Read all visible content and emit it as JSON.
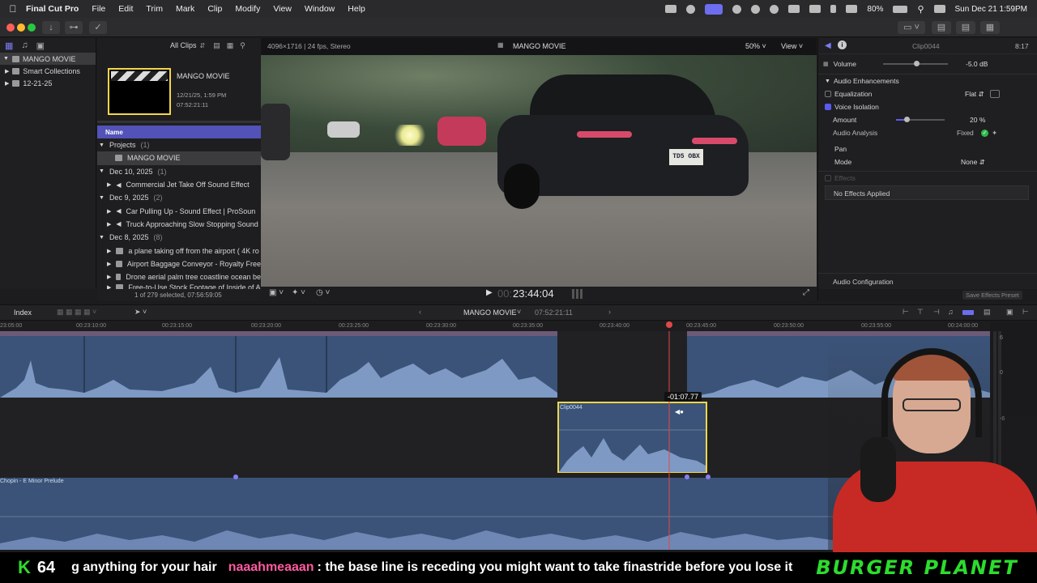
{
  "menubar": {
    "app_name": "Final Cut Pro",
    "menus": [
      "File",
      "Edit",
      "Trim",
      "Mark",
      "Clip",
      "Modify",
      "View",
      "Window",
      "Help"
    ],
    "battery": "80%",
    "datetime": "Sun Dec 21  1:59PM"
  },
  "browser": {
    "library": "MANGO MOVIE",
    "sidebar": [
      "Smart Collections",
      "12-21-25"
    ],
    "filter": "All Clips",
    "project_card": {
      "name": "MANGO MOVIE",
      "date": "12/21/25, 1:59 PM",
      "duration": "07:52:21:11"
    },
    "column_header": "Name",
    "groups": [
      {
        "label": "Projects",
        "count": "(1)",
        "items": [
          "MANGO MOVIE"
        ]
      },
      {
        "label": "Dec 10, 2025",
        "count": "(1)",
        "items": [
          "Commercial Jet Take Off Sound Effect"
        ]
      },
      {
        "label": "Dec 9, 2025",
        "count": "(2)",
        "items": [
          "Car Pulling Up - Sound Effect  |  ProSoun",
          "Truck Approaching Slow Stopping Sound"
        ]
      },
      {
        "label": "Dec 8, 2025",
        "count": "(8)",
        "items": [
          "a plane taking off from the airport ( 4K ro",
          "Airport Baggage Conveyor - Royalty Free",
          "Drone aerial palm tree coastline ocean be",
          "Free-to-Use Stock Footage of Inside of A"
        ]
      }
    ],
    "selection_status": "1 of 279 selected, 07:56:59:05"
  },
  "viewer": {
    "format": "4096×1716 | 24 fps, Stereo",
    "title": "MANGO MOVIE",
    "zoom": "50%",
    "view_label": "View",
    "plate": "TD5 OBX",
    "timecode_dim": "00:",
    "timecode": "23:44:04"
  },
  "inspector": {
    "clip_name": "Clip0044",
    "clip_time": "8:17",
    "volume_label": "Volume",
    "volume_value": "-5.0  dB",
    "enhancements_label": "Audio Enhancements",
    "equalization_label": "Equalization",
    "equalization_value": "Flat",
    "voice_isolation_label": "Voice Isolation",
    "amount_label": "Amount",
    "amount_value": "20  %",
    "analysis_label": "Audio Analysis",
    "analysis_value": "Fixed",
    "pan_label": "Pan",
    "mode_label": "Mode",
    "mode_value": "None",
    "effects_label": "Effects",
    "no_effects": "No Effects Applied",
    "audio_config": "Audio Configuration",
    "save_preset": "Save Effects Preset"
  },
  "timeline": {
    "index_label": "Index",
    "project": "MANGO MOVIE",
    "duration": "07:52:21:11",
    "ruler_ticks": [
      "23:05:00",
      "00:23:10:00",
      "00:23:15:00",
      "00:23:20:00",
      "00:23:25:00",
      "00:23:30:00",
      "00:23:35:00",
      "00:23:40:00",
      "00:23:45:00",
      "00:23:50:00",
      "00:23:55:00",
      "00:24:00:00"
    ],
    "clip_label": "Clip0044",
    "trim_readout": "-01:07.77",
    "music_label": "Chopin - E Minor Prelude",
    "meter_labels": [
      "6",
      "0",
      "-6"
    ]
  },
  "ticker": {
    "score_letter": "K",
    "score_number": "64",
    "text_before": "g anything for your hair",
    "username": "naaahmeaaan",
    "message": ": the base line is receding you might want to take finastride before you lose it",
    "brand": "BURGER PLANET"
  },
  "colors": {
    "accent": "#5a5af0",
    "user_pink": "#ff5aa0",
    "brand_green": "#2ddc2d",
    "selection_yellow": "#f3d64a"
  }
}
